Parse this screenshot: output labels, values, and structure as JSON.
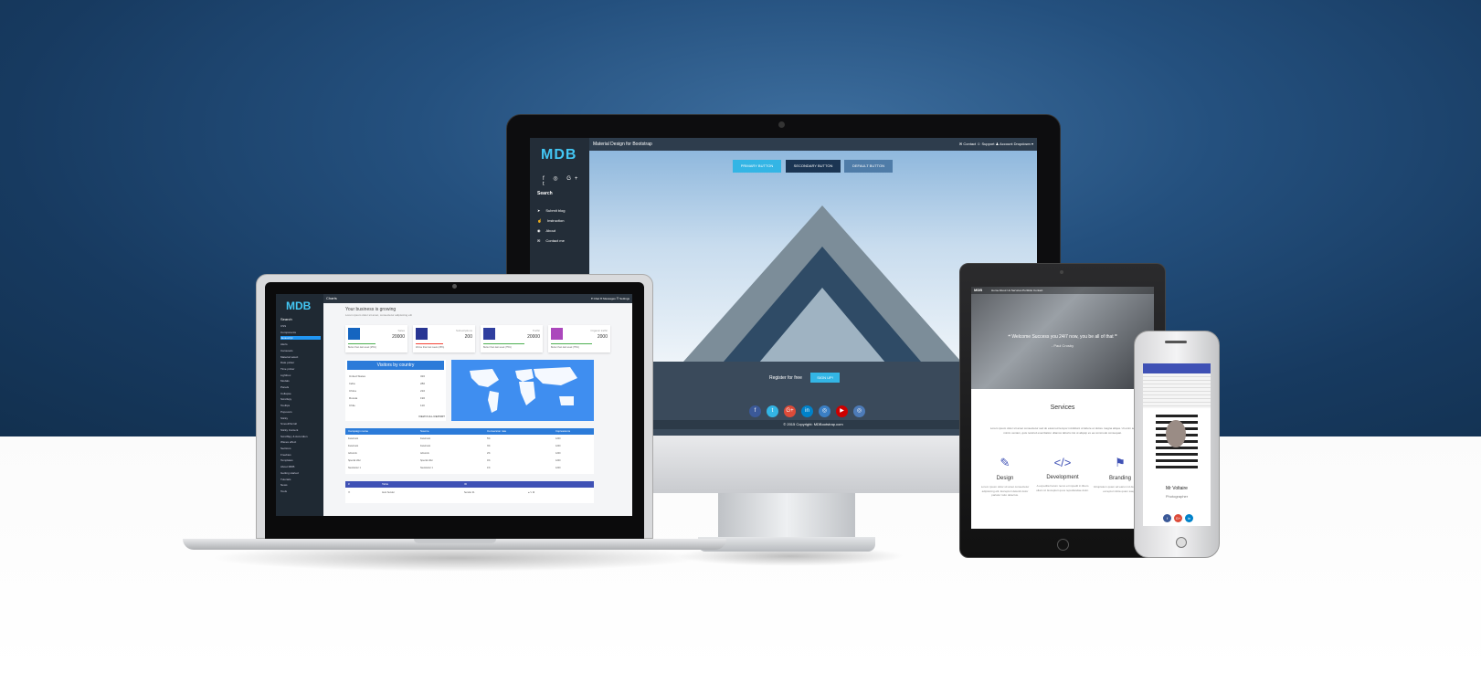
{
  "imac": {
    "logo": "MDB",
    "social": [
      "f",
      "◎",
      "G+",
      "t"
    ],
    "search_label": "Search",
    "nav": [
      "Submit blog",
      "Instruction",
      "About",
      "Contact me"
    ],
    "title": "Material Design for Bootstrap",
    "topnav": "✉ Contact   ☺ Support   ♟ Account   Dropdown ▾",
    "buttons": [
      "PRIMARY BUTTON",
      "SECONDARY BUTTON",
      "DEFAULT BUTTON"
    ],
    "register": "Register for free",
    "signup": "SIGN UP!",
    "footer_icons": [
      "f",
      "t",
      "G+",
      "in",
      "◎",
      "▶",
      "◎"
    ],
    "copyright": "© 2015 Copyright: MDBootstrap.com",
    "colors": {
      "accent": "#33b5e5",
      "footer": "#3a4a5b"
    }
  },
  "laptop": {
    "logo": "MDB",
    "search_label": "Search",
    "nav": [
      "CSS",
      "Components",
      "Javascript",
      "Alerts",
      "Carousels",
      "Material select",
      "Date picker",
      "Time picker",
      "Lightbox",
      "Modals",
      "Panels",
      "Collapse",
      "Scrollspy",
      "Tooltips",
      "Popovers",
      "Sticky",
      "SmoothScroll",
      "Sticky Content",
      "ScrollSpy & Accordion",
      "Waves effect",
      "Sections",
      "Freebies",
      "Templates",
      "About MDB",
      "Getting started",
      "Tutorials",
      "News",
      "Tools"
    ],
    "active_nav": "Javascript",
    "title": "Charts",
    "topnav": "♥ Chat   ✉ Messages   ☰ Settings",
    "heading": "Your business is growing",
    "subheading": "Lorem ipsum dolor sit amet, consectetur adipisicing elit",
    "cards": [
      {
        "label": "Sales",
        "value": "20000",
        "text": "Better than last week (25%)",
        "color": "#1565c0"
      },
      {
        "label": "Subscriptions",
        "value": "200",
        "text": "Worse than last week (25%)",
        "color": "#283593"
      },
      {
        "label": "Traffic",
        "value": "20000",
        "text": "Better than last week (75%)",
        "color": "#303f9f"
      },
      {
        "label": "Organic traffic",
        "value": "2000",
        "text": "Better than last week (75%)",
        "color": "#ab47bc"
      }
    ],
    "visitors_title": "Visitors by country",
    "visitors": [
      {
        "country": "United States",
        "value": "320"
      },
      {
        "country": "India",
        "value": "280"
      },
      {
        "country": "China",
        "value": "210"
      },
      {
        "country": "Russia",
        "value": "190"
      },
      {
        "country": "Chile",
        "value": "110"
      }
    ],
    "report_label": "VIEW FULL REPORT",
    "table_headers": [
      "Campaign name",
      "Source",
      "Conversion rate",
      "Impressions"
    ],
    "table_rows": [
      [
        "Facebook",
        "Facebook",
        "5%",
        "1200"
      ],
      [
        "Facebook",
        "Facebook",
        "3%",
        "1200"
      ],
      [
        "Adwords",
        "Adwords",
        "2%",
        "1200"
      ],
      [
        "Special offer",
        "Special offer",
        "4%",
        "1200"
      ],
      [
        "Newsletter 1",
        "Newsletter 1",
        "1%",
        "1200"
      ]
    ],
    "table2_headers": [
      "#",
      "Table",
      "ID"
    ],
    "table2_row": [
      "☐",
      "Auto Sender",
      "Sender 41",
      "● ✎ ✖"
    ]
  },
  "tablet": {
    "brand": "MDB",
    "nav": "Home   About Us   Services   Portfolio   Contact",
    "quote": "❝ Welcome Success you 24/7 now, you be all of that ❞",
    "author": "- Paul Crosby",
    "services_title": "Services",
    "lorem": "Lorem ipsum dolor sit amet consectetur sed do eiusmod tempor incididunt ut labore et dolore magna aliqua. Ut enim ad minim veniam, quis nostrud exercitation ullamco laboris nisi ut aliquip ex ea commodo consequat.",
    "features": [
      {
        "icon": "brush-icon",
        "glyph": "✎",
        "title": "Design",
        "text": "Lorem ipsum dolor sit amet consectetur adipisicing elit. Excepturi deleniti dolor pariatur ratio delectus."
      },
      {
        "icon": "code-icon",
        "glyph": "</>",
        "title": "Development",
        "text": "A expedita harum nemo et impedit in libero ullam id. Excepturi quos repudiandae dolor."
      },
      {
        "icon": "flag-icon",
        "glyph": "⚑",
        "title": "Branding",
        "text": "Voluptatum quam ad earum id deleniti natus excepturi dicta quam saepe."
      }
    ]
  },
  "phone": {
    "name": "Mr Voltaire",
    "role": "Photographer",
    "icons": [
      "f",
      "G+",
      "in"
    ]
  }
}
